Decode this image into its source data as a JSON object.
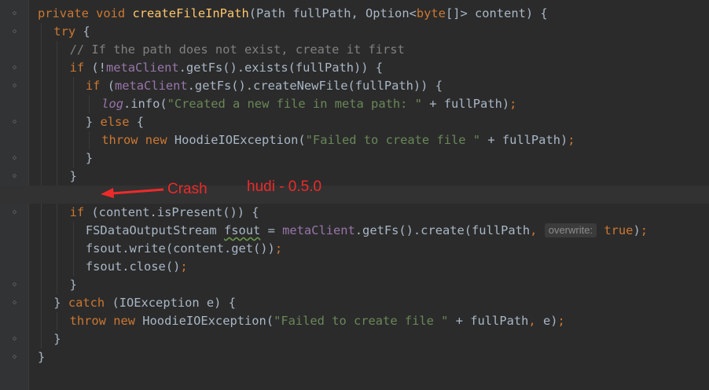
{
  "code_lines": [
    [
      [
        "kw",
        "private void "
      ],
      [
        "fn",
        "createFileInPath"
      ],
      [
        "p",
        "(Path fullPath, Option<"
      ],
      [
        "kw",
        "byte"
      ],
      [
        "p",
        "[]> content) {"
      ]
    ],
    [
      [
        "kw",
        "try "
      ],
      [
        "p",
        "{"
      ]
    ],
    [
      [
        "cm",
        "// If the path does not exist, create it first"
      ]
    ],
    [
      [
        "kw",
        "if "
      ],
      [
        "p",
        "(!"
      ],
      [
        "field",
        "metaClient"
      ],
      [
        "p",
        ".getFs().exists(fullPath)) {"
      ]
    ],
    [
      [
        "kw",
        "if "
      ],
      [
        "p",
        "("
      ],
      [
        "field",
        "metaClient"
      ],
      [
        "p",
        ".getFs().createNewFile(fullPath)) {"
      ]
    ],
    [
      [
        "static-field",
        "log"
      ],
      [
        "p",
        ".info("
      ],
      [
        "str",
        "\"Created a new file in meta path: \""
      ],
      [
        "p",
        " + fullPath)"
      ],
      [
        "kw",
        ";"
      ]
    ],
    [
      [
        "p",
        "} "
      ],
      [
        "kw",
        "else "
      ],
      [
        "p",
        "{"
      ]
    ],
    [
      [
        "kw",
        "throw new "
      ],
      [
        "p",
        "HoodieIOException("
      ],
      [
        "str",
        "\"Failed to create file \""
      ],
      [
        "p",
        " + fullPath)"
      ],
      [
        "kw",
        ";"
      ]
    ],
    [
      [
        "p",
        "}"
      ]
    ],
    [
      [
        "p",
        "}"
      ]
    ],
    [],
    [
      [
        "kw",
        "if "
      ],
      [
        "p",
        "(content.isPresent()) {"
      ]
    ],
    [
      [
        "p",
        "FSDataOutputStream "
      ],
      [
        "squiggle",
        "fsout"
      ],
      [
        "p",
        " = "
      ],
      [
        "field",
        "metaClient"
      ],
      [
        "p",
        ".getFs().create(fullPath"
      ],
      [
        "kw",
        ", "
      ],
      [
        "hint",
        "overwrite:"
      ],
      [
        "p",
        " "
      ],
      [
        "kw",
        "true"
      ],
      [
        "p",
        ")"
      ],
      [
        "kw",
        ";"
      ]
    ],
    [
      [
        "p",
        "fsout.write(content.get())"
      ],
      [
        "kw",
        ";"
      ]
    ],
    [
      [
        "p",
        "fsout.close()"
      ],
      [
        "kw",
        ";"
      ]
    ],
    [
      [
        "p",
        "}"
      ]
    ],
    [
      [
        "p",
        "} "
      ],
      [
        "kw",
        "catch "
      ],
      [
        "p",
        "(IOException e) {"
      ]
    ],
    [
      [
        "kw",
        "throw new "
      ],
      [
        "p",
        "HoodieIOException("
      ],
      [
        "str",
        "\"Failed to create file \""
      ],
      [
        "p",
        " + fullPath"
      ],
      [
        "kw",
        ", "
      ],
      [
        "p",
        "e)"
      ],
      [
        "kw",
        ";"
      ]
    ],
    [
      [
        "p",
        "}"
      ]
    ],
    [
      [
        "p",
        "}"
      ]
    ]
  ],
  "annotations": {
    "crash_label": "Crash",
    "version_label": "hudi - 0.5.0"
  },
  "colors": {
    "background": "#2b2b2b",
    "keyword": "#cc7832",
    "method": "#ffc66d",
    "string": "#6a8759",
    "comment": "#808080",
    "field": "#9876aa",
    "text": "#a9b7c6",
    "annotation": "#ee2a2a"
  }
}
